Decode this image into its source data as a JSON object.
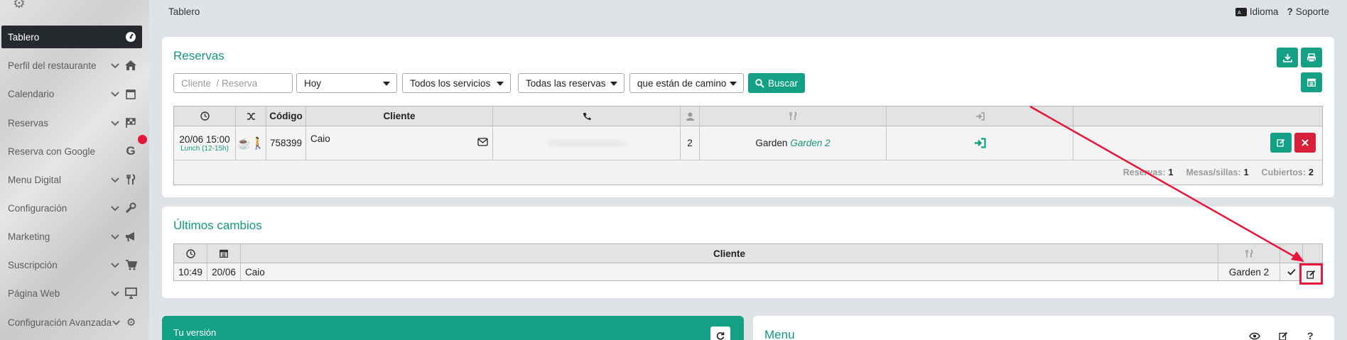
{
  "breadcrumb": "Tablero",
  "topbar": {
    "language": "Idioma",
    "support": "Soporte"
  },
  "sidebar": {
    "items": [
      {
        "label": "Tablero",
        "icon": "dashboard-icon",
        "active": true
      },
      {
        "label": "Perfil del restaurante",
        "icon": "home-icon"
      },
      {
        "label": "Calendario",
        "icon": "calendar-icon"
      },
      {
        "label": "Reservas",
        "icon": "checkered-flag-icon"
      },
      {
        "label": "Reserva con Google",
        "icon": "google-icon"
      },
      {
        "label": "Menu Digital",
        "icon": "utensils-icon"
      },
      {
        "label": "Configuración",
        "icon": "wrench-icon"
      },
      {
        "label": "Marketing",
        "icon": "megaphone-icon"
      },
      {
        "label": "Suscripción",
        "icon": "cart-icon"
      },
      {
        "label": "Página Web",
        "icon": "desktop-icon"
      },
      {
        "label": "Configuración Avanzada",
        "icon": "gears-icon"
      }
    ]
  },
  "reservas": {
    "title": "Reservas",
    "search_placeholder": "Cliente  / Reserva",
    "filters": {
      "date": "Hoy",
      "services": "Todos los servicios",
      "reservations": "Todas las reservas",
      "status": "que están de camino"
    },
    "search_button": "Buscar",
    "columns": {
      "code": "Código",
      "client": "Cliente"
    },
    "row": {
      "date": "20/06 15:00",
      "service": "Lunch (12-15h)",
      "code": "758399",
      "client": "Caio",
      "people": "2",
      "table": "Garden",
      "table_area": "Garden 2"
    },
    "summary": {
      "reservas_label": "Reservas:",
      "reservas_value": "1",
      "mesas_label": "Mesas/sillas:",
      "mesas_value": "1",
      "cubiertos_label": "Cubiertos:",
      "cubiertos_value": "2"
    }
  },
  "ultimos": {
    "title": "Últimos cambios",
    "column_client": "Cliente",
    "row": {
      "time": "10:49",
      "date": "20/06",
      "client": "Caio",
      "table": "Garden 2"
    }
  },
  "version": {
    "title": "Tu versión"
  },
  "menu_card": {
    "title": "Menu"
  },
  "colors": {
    "accent": "#13a085",
    "danger": "#d9203a",
    "highlight": "#e8163b",
    "sidebar_active": "#262a2f"
  }
}
